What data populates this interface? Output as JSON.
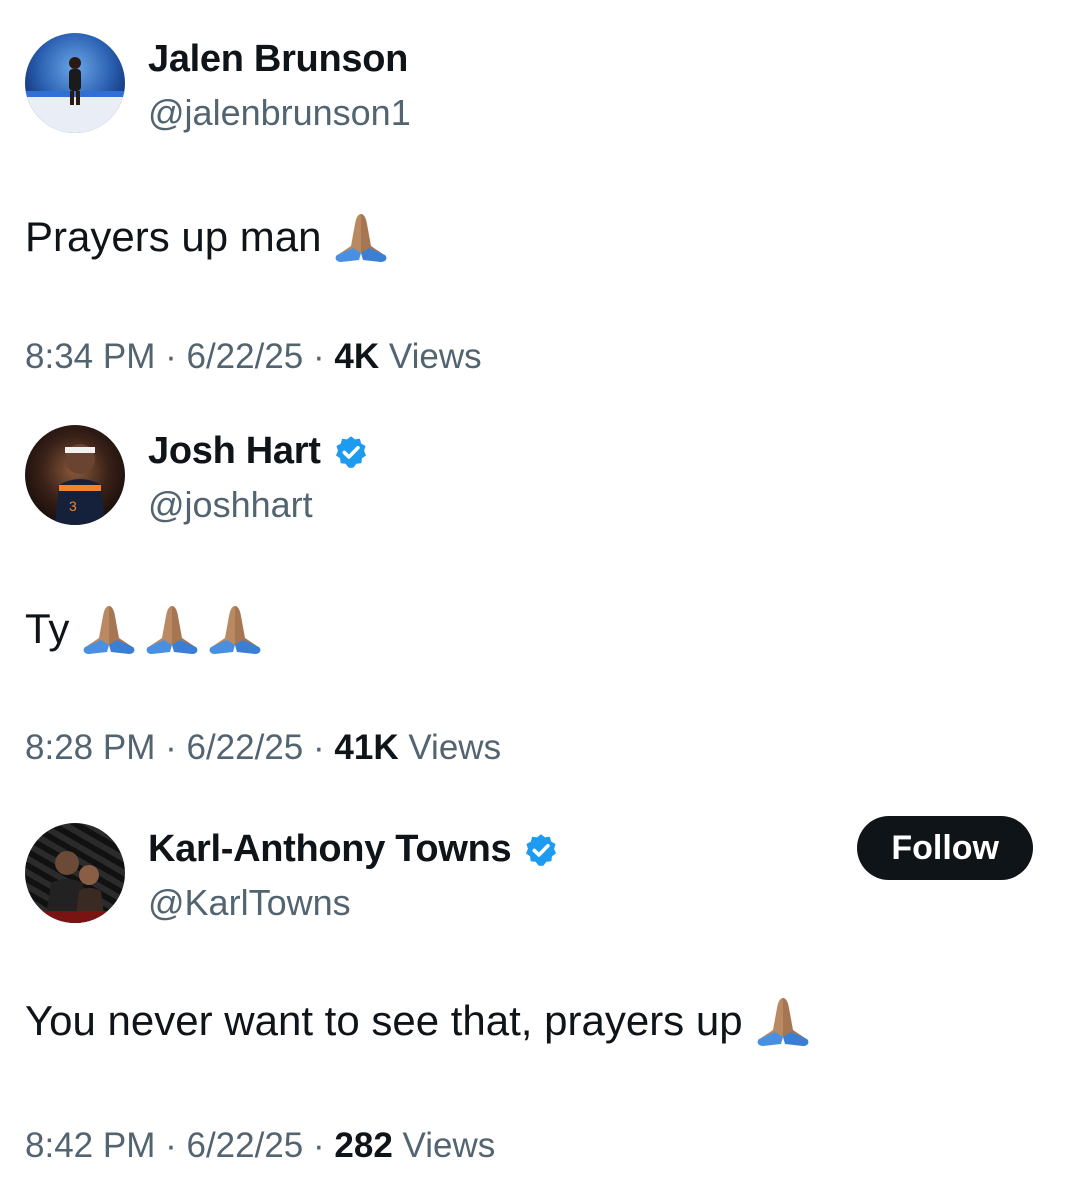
{
  "tweets": [
    {
      "name": "Jalen Brunson",
      "handle": "@jalenbrunson1",
      "verified": false,
      "text": "Prayers up man",
      "emoji": [
        "folded-hands"
      ],
      "time": "8:34 PM",
      "sep1": "·",
      "date": "6/22/25",
      "sep2": "·",
      "views": "4K",
      "views_label": "Views"
    },
    {
      "name": "Josh Hart",
      "handle": "@joshhart",
      "verified": true,
      "text": "Ty",
      "emoji": [
        "folded-hands",
        "folded-hands",
        "folded-hands"
      ],
      "time": "8:28 PM",
      "sep1": "·",
      "date": "6/22/25",
      "sep2": "·",
      "views": "41K",
      "views_label": "Views"
    },
    {
      "name": "Karl-Anthony Towns",
      "handle": "@KarlTowns",
      "verified": true,
      "follow_label": "Follow",
      "text": "You never want to see that, prayers up",
      "emoji": [
        "folded-hands"
      ],
      "time": "8:42 PM",
      "sep1": "·",
      "date": "6/22/25",
      "sep2": "·",
      "views": "282",
      "views_label": "Views"
    }
  ],
  "colors": {
    "text": "#0f1419",
    "secondary": "#536471",
    "verified": "#1d9bf0",
    "follow_bg": "#0f1419"
  }
}
